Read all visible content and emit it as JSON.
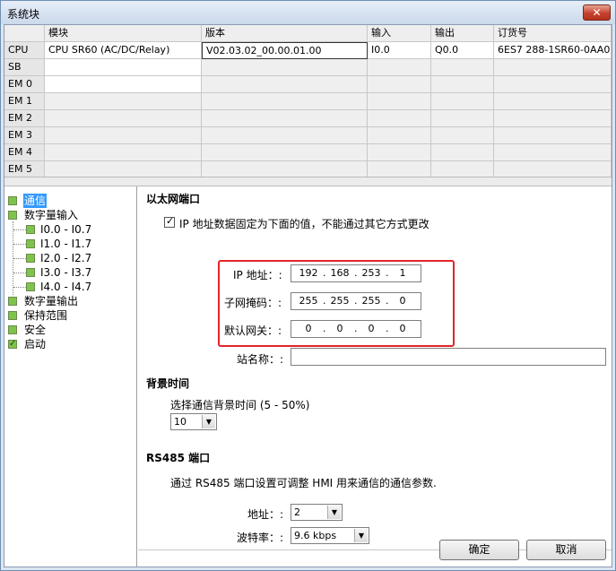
{
  "window": {
    "title": "系统块",
    "close_glyph": "✕"
  },
  "grid": {
    "columns": [
      "",
      "模块",
      "版本",
      "输入",
      "输出",
      "订货号"
    ],
    "rows": [
      {
        "slot": "CPU",
        "module": "CPU SR60 (AC/DC/Relay)",
        "version": "V02.03.02_00.00.01.00",
        "input": "I0.0",
        "output": "Q0.0",
        "order": "6ES7 288-1SR60-0AA0"
      },
      {
        "slot": "SB",
        "module": "",
        "version": "",
        "input": "",
        "output": "",
        "order": ""
      },
      {
        "slot": "EM 0",
        "module": "",
        "version": "",
        "input": "",
        "output": "",
        "order": ""
      },
      {
        "slot": "EM 1",
        "module": "",
        "version": "",
        "input": "",
        "output": "",
        "order": ""
      },
      {
        "slot": "EM 2",
        "module": "",
        "version": "",
        "input": "",
        "output": "",
        "order": ""
      },
      {
        "slot": "EM 3",
        "module": "",
        "version": "",
        "input": "",
        "output": "",
        "order": ""
      },
      {
        "slot": "EM 4",
        "module": "",
        "version": "",
        "input": "",
        "output": "",
        "order": ""
      },
      {
        "slot": "EM 5",
        "module": "",
        "version": "",
        "input": "",
        "output": "",
        "order": ""
      }
    ]
  },
  "tree": {
    "items": [
      {
        "label": "通信",
        "selected": true
      },
      {
        "label": "数字量输入"
      },
      {
        "label": "I0.0 - I0.7"
      },
      {
        "label": "I1.0 - I1.7"
      },
      {
        "label": "I2.0 - I2.7"
      },
      {
        "label": "I3.0 - I3.7"
      },
      {
        "label": "I4.0 - I4.7"
      },
      {
        "label": "数字量输出"
      },
      {
        "label": "保持范围"
      },
      {
        "label": "安全"
      },
      {
        "label": "启动"
      }
    ]
  },
  "ethernet": {
    "heading": "以太网端口",
    "fixed_ip_label": "IP 地址数据固定为下面的值，不能通过其它方式更改",
    "fixed_ip_checked": true,
    "ip_label": "IP 地址：:",
    "ip": [
      "192",
      "168",
      "253",
      "1"
    ],
    "mask_label": "子网掩码：:",
    "mask": [
      "255",
      "255",
      "255",
      "0"
    ],
    "gateway_label": "默认网关：:",
    "gateway": [
      "0",
      "0",
      "0",
      "0"
    ],
    "station_label": "站名称：:",
    "station_value": "",
    "dot": "."
  },
  "background": {
    "heading": "背景时间",
    "label": "选择通信背景时间 (5 - 50%)",
    "value": "10"
  },
  "rs485": {
    "heading": "RS485 端口",
    "description": "通过 RS485 端口设置可调整 HMI 用来通信的通信参数.",
    "address_label": "地址：:",
    "address_value": "2",
    "baud_label": "波特率：:",
    "baud_value": "9.6 kbps"
  },
  "buttons": {
    "ok": "确定",
    "cancel": "取消"
  }
}
